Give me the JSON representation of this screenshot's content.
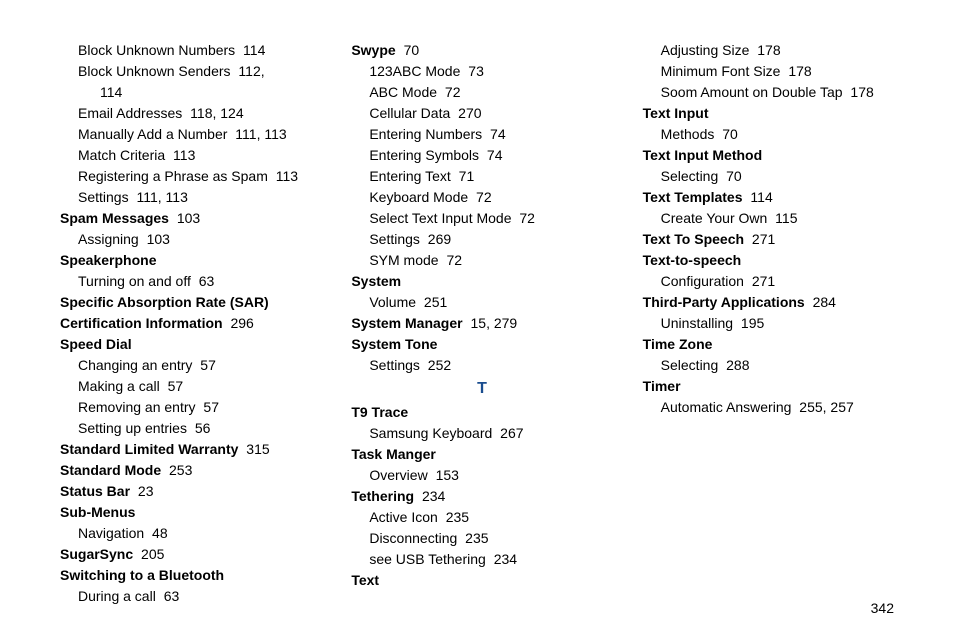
{
  "page_number": "342",
  "col1": [
    {
      "indent": 1,
      "parts": [
        {
          "t": "Block Unknown Numbers"
        },
        {
          "t": " 114",
          "pg": true
        }
      ]
    },
    {
      "indent": 1,
      "parts": [
        {
          "t": "Block Unknown Senders"
        },
        {
          "t": " 112, ",
          "pg": true
        }
      ]
    },
    {
      "indent": 2,
      "parts": [
        {
          "t": "114",
          "pg": true
        }
      ]
    },
    {
      "indent": 1,
      "parts": [
        {
          "t": "Email Addresses"
        },
        {
          "t": " 118, 124",
          "pg": true
        }
      ]
    },
    {
      "indent": 1,
      "parts": [
        {
          "t": "Manually Add a Number"
        },
        {
          "t": " 111, 113",
          "pg": true
        }
      ]
    },
    {
      "indent": 1,
      "parts": [
        {
          "t": "Match Criteria"
        },
        {
          "t": " 113",
          "pg": true
        }
      ]
    },
    {
      "indent": 1,
      "parts": [
        {
          "t": "Registering a Phrase as Spam"
        },
        {
          "t": " 113",
          "pg": true
        }
      ]
    },
    {
      "indent": 1,
      "parts": [
        {
          "t": "Settings"
        },
        {
          "t": " 111, 113",
          "pg": true
        }
      ]
    },
    {
      "indent": 0,
      "parts": [
        {
          "t": "Spam Messages",
          "b": true
        },
        {
          "t": " 103",
          "pg": true
        }
      ]
    },
    {
      "indent": 1,
      "parts": [
        {
          "t": "Assigning"
        },
        {
          "t": " 103",
          "pg": true
        }
      ]
    },
    {
      "indent": 0,
      "parts": [
        {
          "t": "Speakerphone",
          "b": true
        }
      ]
    },
    {
      "indent": 1,
      "parts": [
        {
          "t": "Turning on and off"
        },
        {
          "t": " 63",
          "pg": true
        }
      ]
    },
    {
      "indent": 0,
      "parts": [
        {
          "t": "Specific Absorption Rate (SAR) ",
          "b": true
        }
      ]
    },
    {
      "indent": 0,
      "parts": [
        {
          "t": "Certification Information",
          "b": true
        },
        {
          "t": " 296",
          "pg": true
        }
      ]
    },
    {
      "indent": 0,
      "parts": [
        {
          "t": "Speed Dial",
          "b": true
        }
      ]
    },
    {
      "indent": 1,
      "parts": [
        {
          "t": "Changing an entry"
        },
        {
          "t": " 57",
          "pg": true
        }
      ]
    },
    {
      "indent": 1,
      "parts": [
        {
          "t": "Making a call"
        },
        {
          "t": " 57",
          "pg": true
        }
      ]
    },
    {
      "indent": 1,
      "parts": [
        {
          "t": "Removing an entry"
        },
        {
          "t": " 57",
          "pg": true
        }
      ]
    },
    {
      "indent": 1,
      "parts": [
        {
          "t": "Setting up entries"
        },
        {
          "t": " 56",
          "pg": true
        }
      ]
    },
    {
      "indent": 0,
      "parts": [
        {
          "t": "Standard Limited Warranty",
          "b": true
        },
        {
          "t": " 315",
          "pg": true
        }
      ]
    },
    {
      "indent": 0,
      "parts": [
        {
          "t": "Standard Mode",
          "b": true
        },
        {
          "t": " 253",
          "pg": true
        }
      ]
    },
    {
      "indent": 0,
      "parts": [
        {
          "t": "Status Bar",
          "b": true
        },
        {
          "t": " 23",
          "pg": true
        }
      ]
    },
    {
      "indent": 0,
      "parts": [
        {
          "t": "Sub-Menus",
          "b": true
        }
      ]
    },
    {
      "indent": 1,
      "parts": [
        {
          "t": "Navigation"
        },
        {
          "t": " 48",
          "pg": true
        }
      ]
    }
  ],
  "col2": [
    {
      "indent": 0,
      "parts": [
        {
          "t": "SugarSync",
          "b": true
        },
        {
          "t": " 205",
          "pg": true
        }
      ]
    },
    {
      "indent": 0,
      "parts": [
        {
          "t": "Switching to a Bluetooth",
          "b": true
        }
      ]
    },
    {
      "indent": 1,
      "parts": [
        {
          "t": "During a call"
        },
        {
          "t": " 63",
          "pg": true
        }
      ]
    },
    {
      "indent": 0,
      "parts": [
        {
          "t": "Swype",
          "b": true
        },
        {
          "t": " 70",
          "pg": true
        }
      ]
    },
    {
      "indent": 1,
      "parts": [
        {
          "t": "123ABC Mode"
        },
        {
          "t": " 73",
          "pg": true
        }
      ]
    },
    {
      "indent": 1,
      "parts": [
        {
          "t": "ABC Mode"
        },
        {
          "t": " 72",
          "pg": true
        }
      ]
    },
    {
      "indent": 1,
      "parts": [
        {
          "t": "Cellular Data"
        },
        {
          "t": " 270",
          "pg": true
        }
      ]
    },
    {
      "indent": 1,
      "parts": [
        {
          "t": "Entering Numbers"
        },
        {
          "t": " 74",
          "pg": true
        }
      ]
    },
    {
      "indent": 1,
      "parts": [
        {
          "t": "Entering Symbols"
        },
        {
          "t": " 74",
          "pg": true
        }
      ]
    },
    {
      "indent": 1,
      "parts": [
        {
          "t": "Entering Text"
        },
        {
          "t": " 71",
          "pg": true
        }
      ]
    },
    {
      "indent": 1,
      "parts": [
        {
          "t": "Keyboard Mode"
        },
        {
          "t": " 72",
          "pg": true
        }
      ]
    },
    {
      "indent": 1,
      "parts": [
        {
          "t": "Select Text Input Mode"
        },
        {
          "t": " 72",
          "pg": true
        }
      ]
    },
    {
      "indent": 1,
      "parts": [
        {
          "t": "Settings"
        },
        {
          "t": " 269",
          "pg": true
        }
      ]
    },
    {
      "indent": 1,
      "parts": [
        {
          "t": "SYM mode"
        },
        {
          "t": " 72",
          "pg": true
        }
      ]
    },
    {
      "indent": 0,
      "parts": [
        {
          "t": "System",
          "b": true
        }
      ]
    },
    {
      "indent": 1,
      "parts": [
        {
          "t": "Volume"
        },
        {
          "t": " 251",
          "pg": true
        }
      ]
    },
    {
      "indent": 0,
      "parts": [
        {
          "t": "System Manager",
          "b": true
        },
        {
          "t": " 15, 279",
          "pg": true
        }
      ]
    },
    {
      "indent": 0,
      "parts": [
        {
          "t": "System Tone",
          "b": true
        }
      ]
    },
    {
      "indent": 1,
      "parts": [
        {
          "t": "Settings"
        },
        {
          "t": " 252",
          "pg": true
        }
      ]
    },
    {
      "section": "T"
    },
    {
      "indent": 0,
      "parts": [
        {
          "t": "T9 Trace",
          "b": true
        }
      ]
    },
    {
      "indent": 1,
      "parts": [
        {
          "t": "Samsung Keyboard"
        },
        {
          "t": " 267",
          "pg": true
        }
      ]
    },
    {
      "indent": 0,
      "parts": [
        {
          "t": "Task Manger",
          "b": true
        }
      ]
    },
    {
      "indent": 1,
      "parts": [
        {
          "t": "Overview"
        },
        {
          "t": " 153",
          "pg": true
        }
      ]
    }
  ],
  "col3": [
    {
      "indent": 0,
      "parts": [
        {
          "t": "Tethering",
          "b": true
        },
        {
          "t": " 234",
          "pg": true
        }
      ]
    },
    {
      "indent": 1,
      "parts": [
        {
          "t": "Active Icon"
        },
        {
          "t": " 235",
          "pg": true
        }
      ]
    },
    {
      "indent": 1,
      "parts": [
        {
          "t": "Disconnecting"
        },
        {
          "t": " 235",
          "pg": true
        }
      ]
    },
    {
      "indent": 1,
      "parts": [
        {
          "t": "see USB Tethering"
        },
        {
          "t": " 234",
          "pg": true
        }
      ]
    },
    {
      "indent": 0,
      "parts": [
        {
          "t": "Text",
          "b": true
        }
      ]
    },
    {
      "indent": 1,
      "parts": [
        {
          "t": "Adjusting Size"
        },
        {
          "t": " 178",
          "pg": true
        }
      ]
    },
    {
      "indent": 1,
      "parts": [
        {
          "t": "Minimum Font Size"
        },
        {
          "t": " 178",
          "pg": true
        }
      ]
    },
    {
      "indent": 1,
      "parts": [
        {
          "t": "Soom Amount on Double Tap"
        },
        {
          "t": " 178",
          "pg": true
        }
      ]
    },
    {
      "indent": 0,
      "parts": [
        {
          "t": "Text Input",
          "b": true
        }
      ]
    },
    {
      "indent": 1,
      "parts": [
        {
          "t": "Methods"
        },
        {
          "t": " 70",
          "pg": true
        }
      ]
    },
    {
      "indent": 0,
      "parts": [
        {
          "t": "Text Input Method",
          "b": true
        }
      ]
    },
    {
      "indent": 1,
      "parts": [
        {
          "t": "Selecting"
        },
        {
          "t": " 70",
          "pg": true
        }
      ]
    },
    {
      "indent": 0,
      "parts": [
        {
          "t": "Text Templates",
          "b": true
        },
        {
          "t": " 114",
          "pg": true
        }
      ]
    },
    {
      "indent": 1,
      "parts": [
        {
          "t": "Create Your Own"
        },
        {
          "t": " 115",
          "pg": true
        }
      ]
    },
    {
      "indent": 0,
      "parts": [
        {
          "t": "Text To Speech",
          "b": true
        },
        {
          "t": " 271",
          "pg": true
        }
      ]
    },
    {
      "indent": 0,
      "parts": [
        {
          "t": "Text-to-speech",
          "b": true
        }
      ]
    },
    {
      "indent": 1,
      "parts": [
        {
          "t": "Configuration"
        },
        {
          "t": " 271",
          "pg": true
        }
      ]
    },
    {
      "indent": 0,
      "parts": [
        {
          "t": "Third-Party Applications",
          "b": true
        },
        {
          "t": " 284",
          "pg": true
        }
      ]
    },
    {
      "indent": 1,
      "parts": [
        {
          "t": "Uninstalling"
        },
        {
          "t": " 195",
          "pg": true
        }
      ]
    },
    {
      "indent": 0,
      "parts": [
        {
          "t": "Time Zone",
          "b": true
        }
      ]
    },
    {
      "indent": 1,
      "parts": [
        {
          "t": "Selecting"
        },
        {
          "t": " 288",
          "pg": true
        }
      ]
    },
    {
      "indent": 0,
      "parts": [
        {
          "t": "Timer",
          "b": true
        }
      ]
    },
    {
      "indent": 1,
      "parts": [
        {
          "t": "Automatic Answering"
        },
        {
          "t": " 255, 257",
          "pg": true
        }
      ]
    }
  ]
}
